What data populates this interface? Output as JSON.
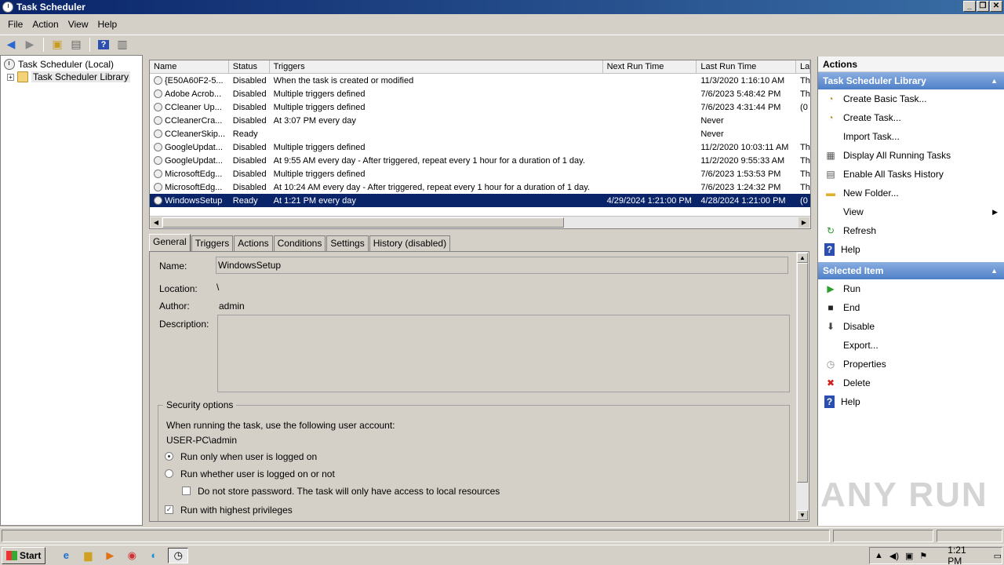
{
  "window": {
    "title": "Task Scheduler"
  },
  "menu": [
    "File",
    "Action",
    "View",
    "Help"
  ],
  "tree": {
    "root": "Task Scheduler (Local)",
    "library": "Task Scheduler Library",
    "expander": "+"
  },
  "table": {
    "columns": [
      "Name",
      "Status",
      "Triggers",
      "Next Run Time",
      "Last Run Time",
      "La"
    ],
    "rows": [
      {
        "name": "{E50A60F2-5...",
        "status": "Disabled",
        "triggers": "When the task is created or modified",
        "next": "",
        "last": "11/3/2020 1:16:10 AM",
        "la": "Th"
      },
      {
        "name": "Adobe Acrob...",
        "status": "Disabled",
        "triggers": "Multiple triggers defined",
        "next": "",
        "last": "7/6/2023 5:48:42 PM",
        "la": "Th"
      },
      {
        "name": "CCleaner Up...",
        "status": "Disabled",
        "triggers": "Multiple triggers defined",
        "next": "",
        "last": "7/6/2023 4:31:44 PM",
        "la": "(0"
      },
      {
        "name": "CCleanerCra...",
        "status": "Disabled",
        "triggers": "At 3:07 PM every day",
        "next": "",
        "last": "Never",
        "la": ""
      },
      {
        "name": "CCleanerSkip...",
        "status": "Ready",
        "triggers": "",
        "next": "",
        "last": "Never",
        "la": ""
      },
      {
        "name": "GoogleUpdat...",
        "status": "Disabled",
        "triggers": "Multiple triggers defined",
        "next": "",
        "last": "11/2/2020 10:03:11 AM",
        "la": "Th"
      },
      {
        "name": "GoogleUpdat...",
        "status": "Disabled",
        "triggers": "At 9:55 AM every day - After triggered, repeat every 1 hour for a duration of 1 day.",
        "next": "",
        "last": "11/2/2020 9:55:33 AM",
        "la": "Th"
      },
      {
        "name": "MicrosoftEdg...",
        "status": "Disabled",
        "triggers": "Multiple triggers defined",
        "next": "",
        "last": "7/6/2023 1:53:53 PM",
        "la": "Th"
      },
      {
        "name": "MicrosoftEdg...",
        "status": "Disabled",
        "triggers": "At 10:24 AM every day - After triggered, repeat every 1 hour for a duration of 1 day.",
        "next": "",
        "last": "7/6/2023 1:24:32 PM",
        "la": "Th"
      },
      {
        "name": "WindowsSetup",
        "status": "Ready",
        "triggers": "At 1:21 PM every day",
        "next": "4/29/2024 1:21:00 PM",
        "last": "4/28/2024 1:21:00 PM",
        "la": "(0",
        "selected": true
      }
    ]
  },
  "tabs": [
    "General",
    "Triggers",
    "Actions",
    "Conditions",
    "Settings",
    "History (disabled)"
  ],
  "general": {
    "name_label": "Name:",
    "name_value": "WindowsSetup",
    "location_label": "Location:",
    "location_value": "\\",
    "author_label": "Author:",
    "author_value": "admin",
    "description_label": "Description:",
    "security_title": "Security options",
    "account_prompt": "When running the task, use the following user account:",
    "account": "USER-PC\\admin",
    "radio_logged_on": "Run only when user is logged on",
    "radio_whether": "Run whether user is logged on or not",
    "check_no_store": "Do not store password.  The task will only have access to local resources",
    "check_highest": "Run with highest privileges"
  },
  "actions_pane": {
    "header": "Actions",
    "section1": "Task Scheduler Library",
    "section1_items": [
      {
        "label": "Create Basic Task...",
        "icon": "create-basic-task-icon"
      },
      {
        "label": "Create Task...",
        "icon": "create-task-icon"
      },
      {
        "label": "Import Task...",
        "icon": ""
      },
      {
        "label": "Display All Running Tasks",
        "icon": "running-tasks-icon"
      },
      {
        "label": "Enable All Tasks History",
        "icon": "history-icon"
      },
      {
        "label": "New Folder...",
        "icon": "folder-icon"
      },
      {
        "label": "View",
        "icon": ""
      },
      {
        "label": "Refresh",
        "icon": "refresh-icon"
      },
      {
        "label": "Help",
        "icon": "help-icon"
      }
    ],
    "section2": "Selected Item",
    "section2_items": [
      {
        "label": "Run",
        "icon": "run-icon"
      },
      {
        "label": "End",
        "icon": "end-icon"
      },
      {
        "label": "Disable",
        "icon": "disable-icon"
      },
      {
        "label": "Export...",
        "icon": ""
      },
      {
        "label": "Properties",
        "icon": "properties-icon"
      },
      {
        "label": "Delete",
        "icon": "delete-icon"
      },
      {
        "label": "Help",
        "icon": "help-icon"
      }
    ]
  },
  "taskbar": {
    "start": "Start",
    "clock": "1:21 PM"
  },
  "watermark": "ANY RUN",
  "colors": {
    "selection": "#0a246a",
    "section_header": "#4f80c8"
  }
}
